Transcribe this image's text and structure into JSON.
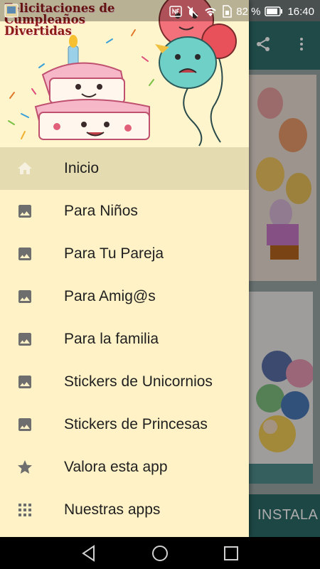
{
  "status_bar": {
    "battery_percent": "82 %",
    "time": "16:40",
    "icons": [
      "app-notification-icon",
      "nfc-icon",
      "mute-icon",
      "wifi-icon",
      "sim-icon",
      "battery-icon"
    ]
  },
  "app": {
    "install_label": "INSTALA",
    "toolbar_icons": [
      "share-icon",
      "more-vert-icon"
    ]
  },
  "drawer": {
    "header_title": "Felicitaciones de Cumpleaños Divertidas",
    "items": [
      {
        "label": "Inicio",
        "icon": "home-icon",
        "active": true
      },
      {
        "label": "Para Niños",
        "icon": "image-icon"
      },
      {
        "label": "Para Tu Pareja",
        "icon": "image-icon"
      },
      {
        "label": "Para Amig@s",
        "icon": "image-icon"
      },
      {
        "label": "Para la familia",
        "icon": "image-icon"
      },
      {
        "label": "Stickers de Unicornios",
        "icon": "image-icon"
      },
      {
        "label": "Stickers de Princesas",
        "icon": "image-icon"
      },
      {
        "label": "Valora esta app",
        "icon": "star-icon"
      },
      {
        "label": "Nuestras apps",
        "icon": "apps-grid-icon"
      }
    ]
  },
  "nav_bar": {
    "buttons": [
      "back-icon",
      "home-circle-icon",
      "recents-icon"
    ]
  },
  "colors": {
    "drawer_background": "#fff2c6",
    "active_item": "#e5dbb0",
    "toolbar": "#2f6f6c",
    "icon_gray": "#6e6e6e",
    "title_red": "#8b1a17"
  }
}
